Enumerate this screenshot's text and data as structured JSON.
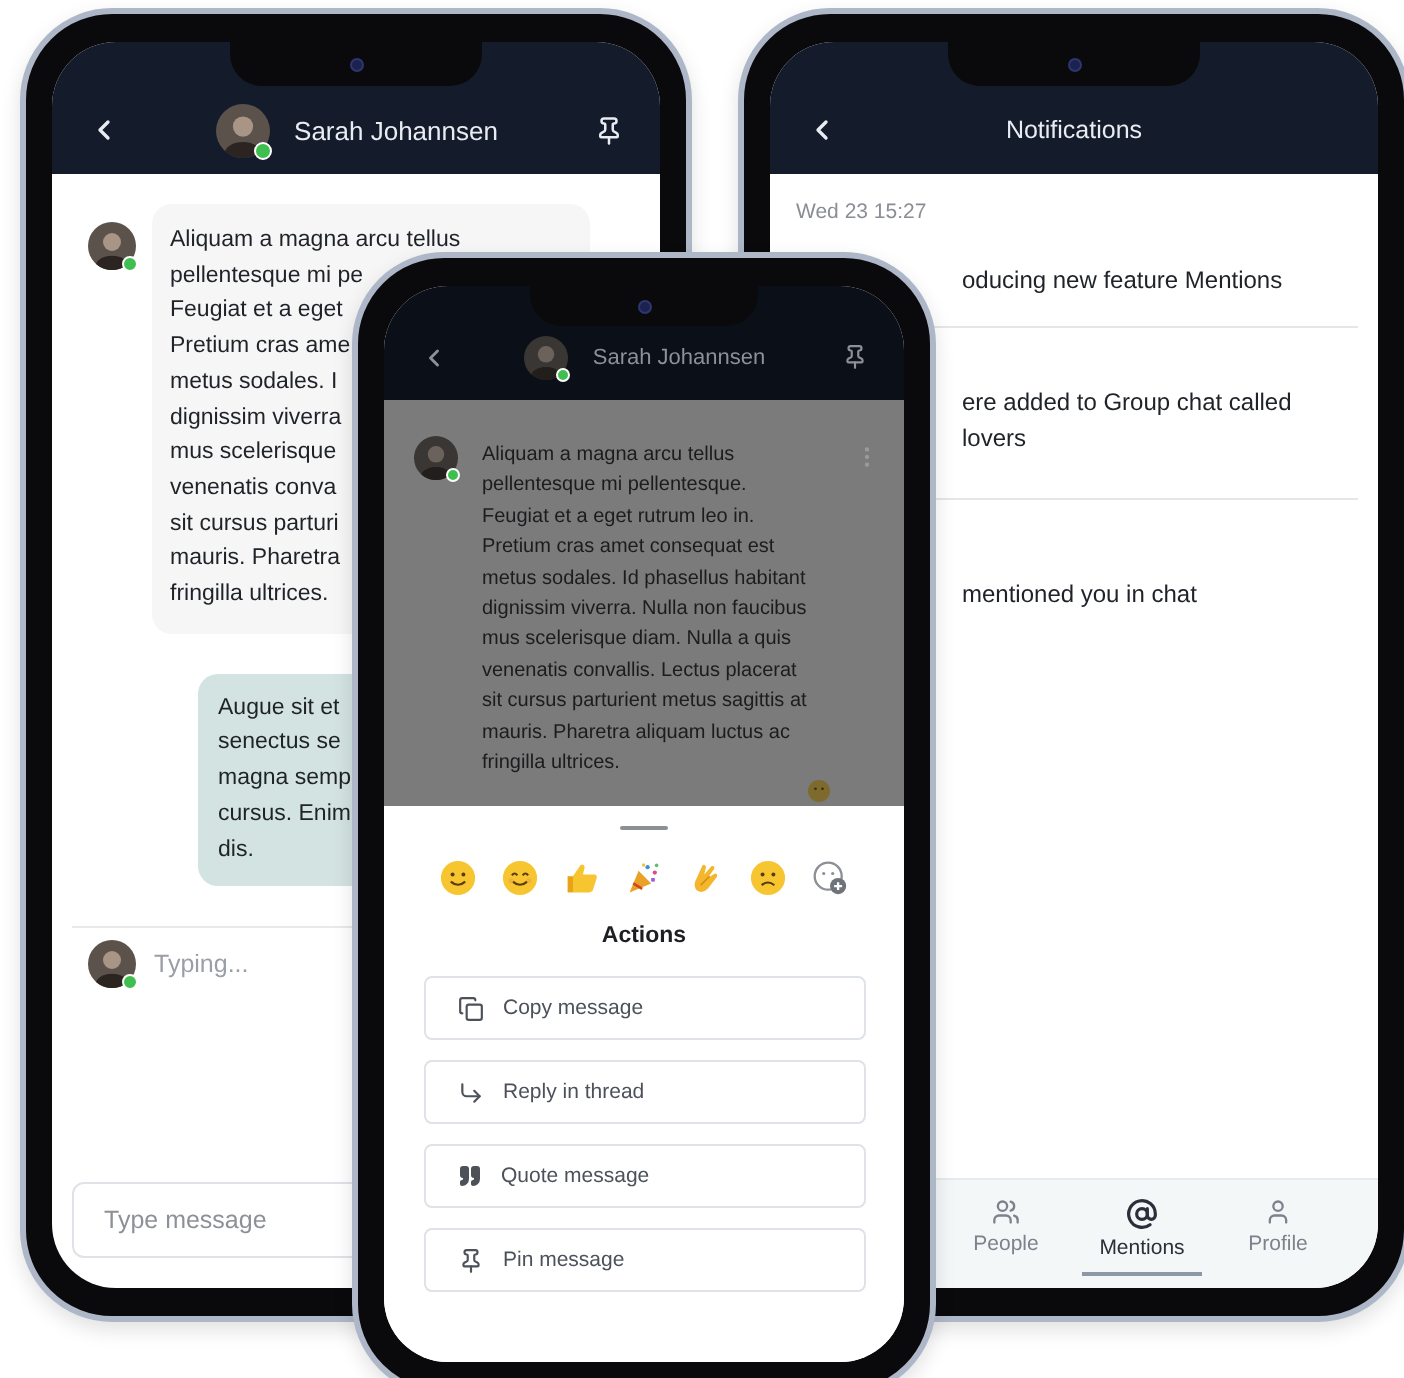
{
  "chat_screen": {
    "header": {
      "title": "Sarah Johannsen",
      "online": true
    },
    "messages": [
      {
        "kind": "incoming",
        "online": true,
        "lines": [
          "Aliquam a magna arcu tellus",
          "pellentesque mi pe",
          "Feugiat et a eget",
          "Pretium cras ame",
          "metus sodales. I",
          "dignissim viverra",
          "mus scelerisque",
          "venenatis conva",
          "sit cursus parturi",
          "mauris. Pharetra",
          "fringilla ultrices."
        ]
      },
      {
        "kind": "outgoing",
        "lines": [
          "Augue sit et",
          "senectus se",
          "magna semp",
          "cursus. Enim",
          "dis."
        ]
      }
    ],
    "typing": {
      "text": "Typing...",
      "online": true
    },
    "composer": {
      "placeholder": "Type message"
    }
  },
  "notifications_screen": {
    "title": "Notifications",
    "date": "Wed 23 15:27",
    "items": [
      {
        "lines": [
          "oducing new feature Mentions"
        ]
      },
      {
        "lines": [
          "ere added to Group chat called",
          "lovers"
        ]
      },
      {
        "lines": [
          "mentioned you in chat"
        ]
      }
    ],
    "tabs": [
      {
        "kind": "people",
        "label": "People",
        "selected": false
      },
      {
        "kind": "mention",
        "label": "Mentions",
        "selected": true
      },
      {
        "kind": "profile",
        "label": "Profile",
        "selected": false
      }
    ]
  },
  "actions_screen": {
    "header": {
      "title": "Sarah Johannsen",
      "online": true
    },
    "message": {
      "online": true,
      "lines": [
        "Aliquam a magna arcu tellus",
        "pellentesque mi pellentesque.",
        "Feugiat et a eget rutrum leo in.",
        "Pretium cras amet consequat est",
        "metus sodales. Id phasellus habitant",
        "dignissim viverra. Nulla non faucibus",
        "mus scelerisque diam. Nulla a quis",
        "venenatis convallis. Lectus placerat",
        "sit cursus parturient metus sagittis at",
        "mauris. Pharetra aliquam luctus ac",
        "fringilla ultrices."
      ]
    },
    "reactions": [
      {
        "kind": "smile"
      },
      {
        "kind": "grin"
      },
      {
        "kind": "thumbs_up"
      },
      {
        "kind": "party"
      },
      {
        "kind": "clap"
      },
      {
        "kind": "frown"
      },
      {
        "kind": "add"
      }
    ],
    "title": "Actions",
    "actions": [
      {
        "kind": "copy",
        "label": "Copy message"
      },
      {
        "kind": "reply",
        "label": "Reply in thread"
      },
      {
        "kind": "quote",
        "label": "Quote message"
      },
      {
        "kind": "pin",
        "label": "Pin message"
      }
    ]
  }
}
